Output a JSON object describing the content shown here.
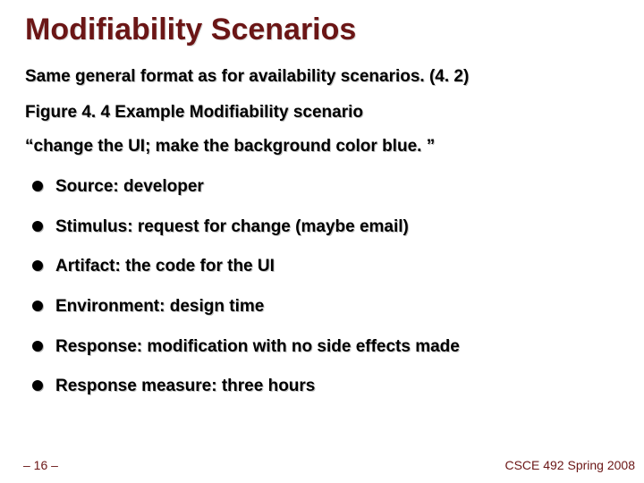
{
  "title": "Modifiability Scenarios",
  "intro": "Same general format as for availability scenarios. (4. 2)",
  "figure_line": "Figure 4. 4 Example Modifiability scenario",
  "quote": "“change the UI; make the background color blue. ”",
  "bullets": [
    "Source: developer",
    "Stimulus: request for change (maybe email)",
    "Artifact: the code for the UI",
    "Environment: design time",
    "Response: modification with no side effects made",
    "Response measure: three hours"
  ],
  "footer": {
    "page": "– 16 –",
    "course": "CSCE 492 Spring 2008"
  }
}
